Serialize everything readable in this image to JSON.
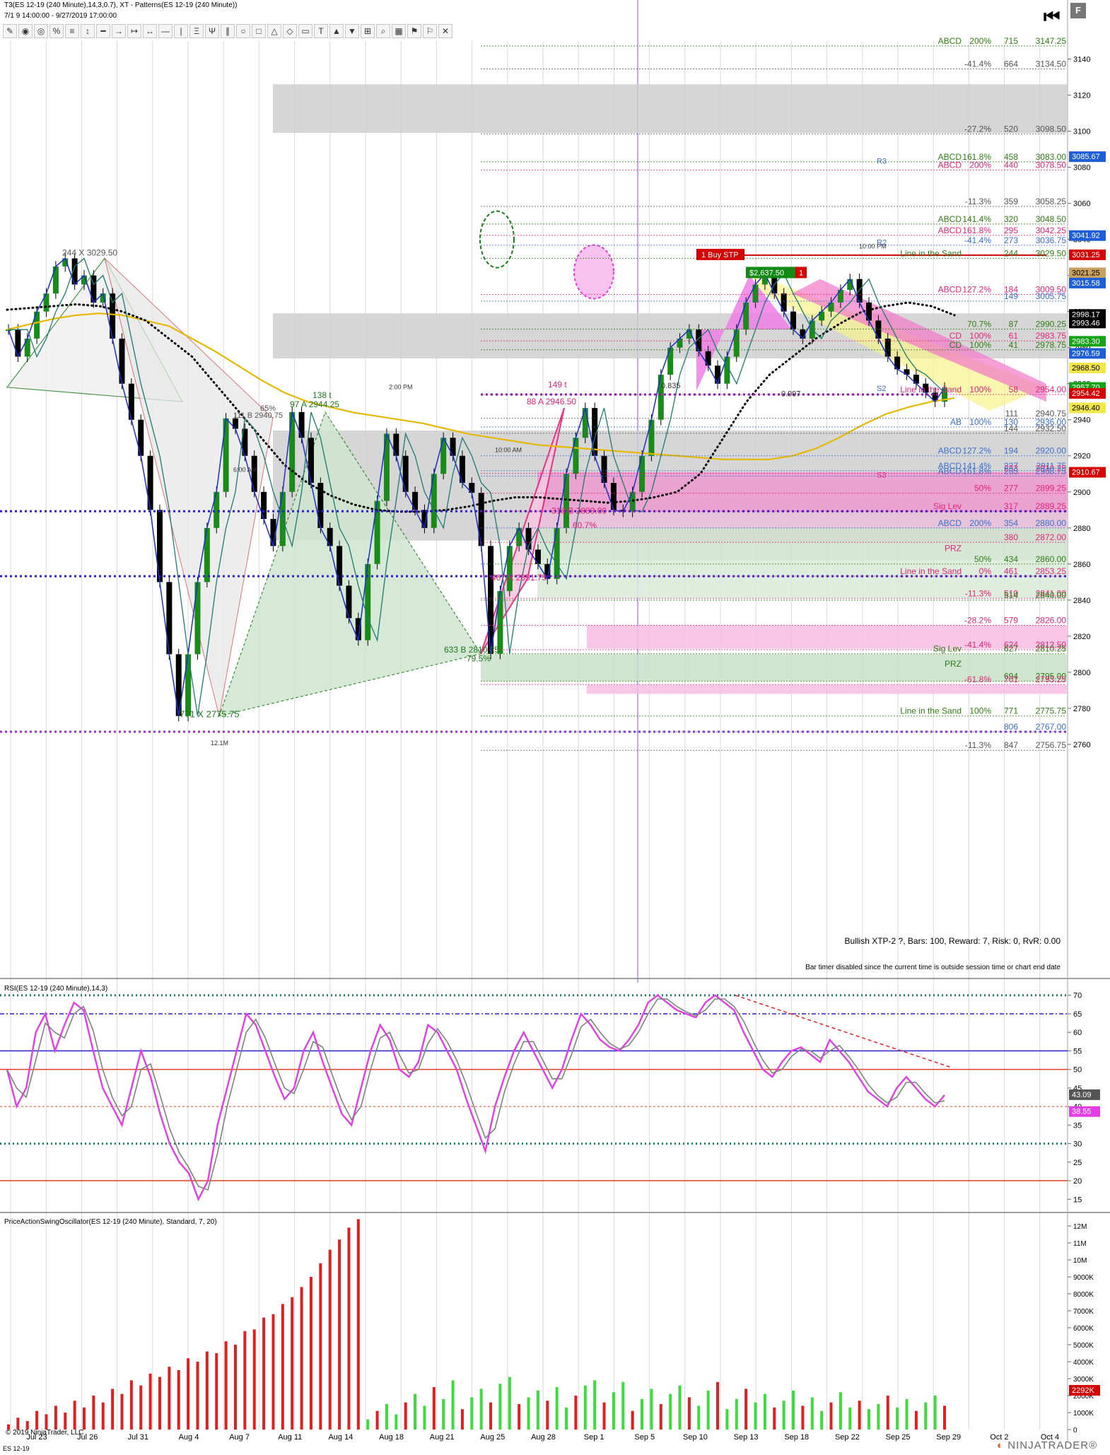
{
  "header": {
    "title": "T3(ES 12-19 (240 Minute),14,3,0.7), XT - Patterns(ES 12-19 (240 Minute))",
    "date_range_prefix": "7/1",
    "date_range": "9 14:00:00 - 9/27/2019 17:00:00",
    "toolbar_icons": [
      "pencil-icon",
      "eye-icon",
      "eye-outline-icon",
      "percent-icon",
      "lines-icon",
      "scale-icon",
      "dash-icon",
      "arrow-line-icon",
      "ray-icon",
      "extended-line-icon",
      "horizontal-line-icon",
      "vertical-line-icon",
      "fib-icon",
      "pitchfork-icon",
      "parallel-icon",
      "ellipse-icon",
      "rectangle-icon",
      "triangle-icon",
      "polygon-icon",
      "region-icon",
      "text-icon",
      "arrow-up-icon",
      "arrow-down-icon",
      "ruler-icon",
      "zoom-icon",
      "chart-icon",
      "risk-icon",
      "flag-icon",
      "pattern-icon"
    ]
  },
  "colors": {
    "up_candle": "#1a8a1a",
    "down_candle": "#000000",
    "rsi_line": "#e23ee6",
    "rsi_signal": "#808080",
    "abcd_green": "#2e7d12",
    "abcd_pink": "#e6237a",
    "abcd_blue": "#3a6fd0",
    "price_tag_green": "#17a317",
    "price_tag_red": "#d40000",
    "price_tag_blue": "#1e5fd6",
    "sma_yellow": "#e6b800",
    "volume_up": "#3ddc3d",
    "volume_down": "#e02020"
  },
  "chart_data": [
    {
      "type": "candlestick",
      "title": "",
      "x_tick_labels": [
        "Jul 23",
        "Jul 26",
        "Jul 31",
        "Aug 4",
        "Aug 7",
        "Aug 11",
        "Aug 14",
        "Aug 18",
        "Aug 21",
        "Aug 25",
        "Aug 28",
        "Sep 1",
        "Sep 5",
        "Sep 10",
        "Sep 13",
        "Sep 18",
        "Sep 22",
        "Sep 25",
        "Sep 29",
        "Oct 2",
        "Oct 4"
      ],
      "y_ticks": [
        3140,
        3120,
        3100,
        3080,
        3060,
        3040,
        3020,
        3000,
        2980,
        2960,
        2940,
        2920,
        2900,
        2880,
        2860,
        2840,
        2820,
        2800,
        2780,
        2760
      ],
      "ylim": [
        2758,
        3150
      ],
      "close_series": [
        2990,
        2975,
        2985,
        3000,
        3010,
        3025,
        3029.5,
        3015,
        3020,
        3005,
        3010,
        2985,
        2960,
        2940,
        2920,
        2890,
        2850,
        2810,
        2775.75,
        2810,
        2850,
        2880,
        2900,
        2940.75,
        2935,
        2920,
        2900,
        2885,
        2870,
        2900,
        2944.25,
        2930,
        2905,
        2880,
        2870,
        2848,
        2830,
        2817.75,
        2860,
        2895,
        2932.25,
        2920,
        2900,
        2890,
        2880,
        2910,
        2930,
        2920,
        2905,
        2899.5,
        2870,
        2810.25,
        2845,
        2870,
        2880,
        2868,
        2860,
        2851.75,
        2880,
        2910,
        2930,
        2946.5,
        2920,
        2905,
        2890,
        2889,
        2900,
        2920,
        2940,
        2965,
        2980,
        2985,
        2990,
        2978,
        2970,
        2960,
        2975,
        2990,
        3005,
        3015,
        3021,
        3010,
        3000,
        2990,
        2985,
        2995,
        3000,
        3005,
        3012,
        3018,
        3005,
        2995,
        2985,
        2975,
        2968,
        2965,
        2960,
        2955,
        2950,
        2957.7
      ],
      "sma_values": [
        2990,
        2993,
        2996,
        2998,
        2999,
        2998,
        2995,
        2992,
        2985,
        2978,
        2970,
        2962,
        2955,
        2950,
        2947,
        2944,
        2942,
        2940,
        2938,
        2935,
        2932,
        2930,
        2928,
        2926,
        2925,
        2924,
        2923,
        2922,
        2921,
        2920,
        2919,
        2918,
        2918,
        2918,
        2920,
        2924,
        2930,
        2937,
        2943,
        2947,
        2950,
        2952
      ],
      "trail_values": [
        3001,
        3002,
        3003,
        3004,
        3003,
        3000,
        2995,
        2985,
        2975,
        2960,
        2945,
        2930,
        2915,
        2905,
        2898,
        2893,
        2890,
        2889,
        2889,
        2890,
        2892,
        2895,
        2897,
        2897,
        2896,
        2895,
        2894,
        2895,
        2897,
        2900,
        2910,
        2930,
        2950,
        2965,
        2975,
        2985,
        2993,
        3000,
        3003,
        3005,
        3003,
        2998
      ],
      "abcd_levels": [
        {
          "label": "ABCD",
          "pct": "200%",
          "bars": "715",
          "price": "3147.25",
          "color": "green"
        },
        {
          "label": "",
          "pct": "-41.4%",
          "bars": "664",
          "price": "3134.50",
          "color": "gray"
        },
        {
          "label": "",
          "pct": "-27.2%",
          "bars": "520",
          "price": "3098.50",
          "color": "gray"
        },
        {
          "label": "ABCD",
          "pct": "161.8%",
          "bars": "458",
          "price": "3083.00",
          "color": "green"
        },
        {
          "label": "ABCD",
          "pct": "200%",
          "bars": "440",
          "price": "3078.50",
          "color": "pink"
        },
        {
          "label": "",
          "pct": "-11.3%",
          "bars": "359",
          "price": "3058.25",
          "color": "gray"
        },
        {
          "label": "ABCD",
          "pct": "141.4%",
          "bars": "320",
          "price": "3048.50",
          "color": "green"
        },
        {
          "label": "ABCD",
          "pct": "161.8%",
          "bars": "295",
          "price": "3042.25",
          "color": "pink"
        },
        {
          "label": "",
          "pct": "-41.4%",
          "bars": "273",
          "price": "3036.75",
          "color": "blue"
        },
        {
          "label": "Line in the Sand",
          "pct": "",
          "bars": "244",
          "price": "3029.50",
          "color": "green"
        },
        {
          "label": "ABCD",
          "pct": "127.2%",
          "bars": "184",
          "price": "3009.50",
          "color": "pink"
        },
        {
          "label": "",
          "pct": "",
          "bars": "149",
          "price": "3005.75",
          "color": "blue"
        },
        {
          "label": "",
          "pct": "70.7%",
          "bars": "87",
          "price": "2990.25",
          "color": "green"
        },
        {
          "label": "CD",
          "pct": "100%",
          "bars": "61",
          "price": "2983.75",
          "color": "pink"
        },
        {
          "label": "CD",
          "pct": "100%",
          "bars": "41",
          "price": "2978.75",
          "color": "green"
        },
        {
          "label": "Line in the Sand",
          "pct": "100%",
          "bars": "58",
          "price": "2954.00",
          "color": "pink"
        },
        {
          "label": "",
          "pct": "",
          "bars": "111",
          "price": "2940.75",
          "color": "gray"
        },
        {
          "label": "AB",
          "pct": "100%",
          "bars": "130",
          "price": "2936.00",
          "color": "blue"
        },
        {
          "label": "",
          "pct": "",
          "bars": "144",
          "price": "2932.50",
          "color": "gray"
        },
        {
          "label": "ABCD",
          "pct": "127.2%",
          "bars": "194",
          "price": "2920.00",
          "color": "blue"
        },
        {
          "label": "ABCD",
          "pct": "141.4%",
          "bars": "227",
          "price": "2911.75",
          "color": "blue"
        },
        {
          "label": "",
          "pct": "",
          "bars": "233",
          "price": "2910.25",
          "color": "pink"
        },
        {
          "label": "ABCD",
          "pct": "161.8%",
          "bars": "265",
          "price": "2908.75",
          "color": "blue"
        },
        {
          "label": "",
          "pct": "50%",
          "bars": "277",
          "price": "2899.25",
          "color": "pink"
        },
        {
          "label": "Sig Lev",
          "pct": "",
          "bars": "317",
          "price": "2889.25",
          "color": "pink"
        },
        {
          "label": "ABCD",
          "pct": "200%",
          "bars": "354",
          "price": "2880.00",
          "color": "blue"
        },
        {
          "label": "",
          "pct": "",
          "bars": "380",
          "price": "2872.00",
          "color": "pink"
        },
        {
          "label": "PRZ",
          "pct": "",
          "bars": "",
          "price": "",
          "color": "pink"
        },
        {
          "label": "",
          "pct": "50%",
          "bars": "434",
          "price": "2860.00",
          "color": "green"
        },
        {
          "label": "Line in the Sand",
          "pct": "0%",
          "bars": "461",
          "price": "2853.25",
          "color": "pink"
        },
        {
          "label": "",
          "pct": "-11.3%",
          "bars": "510",
          "price": "2841.00",
          "color": "pink"
        },
        {
          "label": "",
          "pct": "",
          "bars": "514",
          "price": "2840.00",
          "color": "green"
        },
        {
          "label": "",
          "pct": "-28.2%",
          "bars": "579",
          "price": "2826.00",
          "color": "pink"
        },
        {
          "label": "",
          "pct": "-41.4%",
          "bars": "624",
          "price": "2812.50",
          "color": "pink"
        },
        {
          "label": "Sig Lev",
          "pct": "",
          "bars": "627",
          "price": "2810.25",
          "color": "green"
        },
        {
          "label": "PRZ",
          "pct": "",
          "bars": "",
          "price": "",
          "color": "green"
        },
        {
          "label": "",
          "pct": "",
          "bars": "694",
          "price": "2795.00",
          "color": "green"
        },
        {
          "label": "",
          "pct": "-61.8%",
          "bars": "701",
          "price": "2793.25",
          "color": "pink"
        },
        {
          "label": "Line in the Sand",
          "pct": "100%",
          "bars": "771",
          "price": "2775.75",
          "color": "green"
        },
        {
          "label": "",
          "pct": "",
          "bars": "806",
          "price": "2767.00",
          "color": "blue"
        },
        {
          "label": "",
          "pct": "-11.3%",
          "bars": "847",
          "price": "2756.75",
          "color": "gray"
        }
      ],
      "price_tags": [
        {
          "price": "3085.67",
          "color": "blue"
        },
        {
          "price": "3041.92",
          "color": "blue"
        },
        {
          "price": "3031.25",
          "color": "red"
        },
        {
          "price": "3021.25",
          "color": "tan"
        },
        {
          "price": "3015.58",
          "color": "blue"
        },
        {
          "price": "2998.17",
          "color": "black"
        },
        {
          "price": "2993.46",
          "color": "black"
        },
        {
          "price": "2983.30",
          "color": "green"
        },
        {
          "price": "2976.59",
          "color": "blue"
        },
        {
          "price": "2968.50",
          "color": "yellow"
        },
        {
          "price": "2957.70",
          "color": "green"
        },
        {
          "price": "2954.42",
          "color": "red"
        },
        {
          "price": "2946.40",
          "color": "yellow"
        },
        {
          "price": "2910.67",
          "color": "red"
        }
      ],
      "annotations": {
        "top_left_x": "244  X  3029.50",
        "a_label": "97  A  2944.25",
        "ab_label": "138 t",
        "a2": "88  A  2946.50",
        "pct_65": "65%",
        "pct_111": "111  B  2940.75",
        "a3": "149 t",
        "b_low": "633  B  2810.25",
        "pct_795": "79.5%",
        "x_low": "467  X  2851.75",
        "b2": "318  B  2889.00",
        "pct_607": "60.7%",
        "low_x": "771 X 2775.75",
        "low_vol": "12.1M",
        "buy_stp": "1  Buy STP",
        "pnl": "$2,637.50",
        "pnl_qty": "1",
        "r2": "R2",
        "r3": "R3",
        "s2": "S2",
        "s3": "S3",
        "val_0835": "0.835",
        "val_0997": "0.997",
        "time_10pm": "10:00 PM",
        "time_2pm": "2:00 PM",
        "time_10am": "10:00 AM",
        "time_6am": "6:00 AM",
        "status_1": "Bullish XTP-2 ?, Bars: 100, Reward: 7, Risk: 0, RvR: 0.00",
        "status_2": "Bar timer disabled since the current time is outside session time or chart end date"
      }
    },
    {
      "type": "line",
      "title": "RSI(ES 12-19 (240 Minute),14,3)",
      "y_ticks": [
        70,
        65,
        60,
        55,
        50,
        45,
        40,
        35,
        30,
        25,
        20,
        15
      ],
      "ylim": [
        12,
        73
      ],
      "levels": [
        70,
        65,
        55,
        50,
        40,
        30,
        20
      ],
      "rsi": [
        50,
        40,
        45,
        60,
        65,
        55,
        62,
        68,
        66,
        55,
        45,
        40,
        35,
        45,
        55,
        48,
        38,
        30,
        25,
        22,
        15,
        20,
        35,
        45,
        55,
        65,
        62,
        55,
        48,
        42,
        45,
        55,
        60,
        52,
        45,
        38,
        35,
        45,
        55,
        62,
        58,
        50,
        48,
        52,
        62,
        60,
        55,
        50,
        42,
        35,
        28,
        40,
        48,
        55,
        60,
        55,
        50,
        45,
        50,
        58,
        65,
        62,
        58,
        56,
        55,
        58,
        62,
        68,
        70,
        68,
        66,
        65,
        64,
        68,
        70,
        68,
        66,
        60,
        55,
        50,
        48,
        52,
        55,
        56,
        54,
        52,
        58,
        55,
        52,
        48,
        44,
        42,
        40,
        45,
        48,
        45,
        42,
        40,
        43.09
      ],
      "signal_last": "43.09",
      "rsi_last": "38.55"
    },
    {
      "type": "bar",
      "title": "PriceActionSwingOscillator(ES 12-19 (240 Minute), Standard, 7, 20)",
      "y_ticks": [
        "12M",
        "11M",
        "10M",
        "9000K",
        "8000K",
        "7000K",
        "6000K",
        "5000K",
        "4000K",
        "3000K",
        "2000K",
        "1000K",
        "0"
      ],
      "ylim": [
        0,
        12500000
      ],
      "values": [
        300000,
        700000,
        500000,
        1100000,
        900000,
        1400000,
        1000000,
        1700000,
        1300000,
        2000000,
        1600000,
        2400000,
        2100000,
        2900000,
        2600000,
        3300000,
        3100000,
        3700000,
        3500000,
        4200000,
        4000000,
        4600000,
        4500000,
        5200000,
        5000000,
        5800000,
        5900000,
        6600000,
        6800000,
        7400000,
        7800000,
        8400000,
        9000000,
        9800000,
        10600000,
        11200000,
        11900000,
        12400000,
        600000,
        1100000,
        1500000,
        900000,
        1600000,
        2100000,
        1400000,
        2500000,
        1800000,
        2900000,
        1200000,
        1900000,
        2400000,
        1600000,
        2700000,
        3100000,
        1500000,
        1900000,
        2300000,
        1700000,
        2500000,
        1300000,
        2000000,
        2600000,
        2900000,
        1600000,
        2200000,
        2800000,
        1100000,
        1800000,
        2400000,
        1500000,
        2100000,
        2600000,
        1900000,
        1400000,
        2300000,
        2800000,
        1200000,
        1800000,
        2400000,
        1600000,
        2100000,
        1300000,
        1700000,
        2300000,
        1400000,
        1900000,
        1100000,
        1600000,
        2200000,
        1300000,
        1700000,
        1200000,
        1500000,
        2000000,
        1300000,
        1800000,
        1100000,
        1600000,
        2000000,
        1400000
      ],
      "last_value": "2292K"
    }
  ],
  "footer": {
    "copyright": "© 2019 NinjaTrader, LLC",
    "instrument": "ES 12-19",
    "brand_prefix": "",
    "brand": "NINJATRADER®"
  }
}
